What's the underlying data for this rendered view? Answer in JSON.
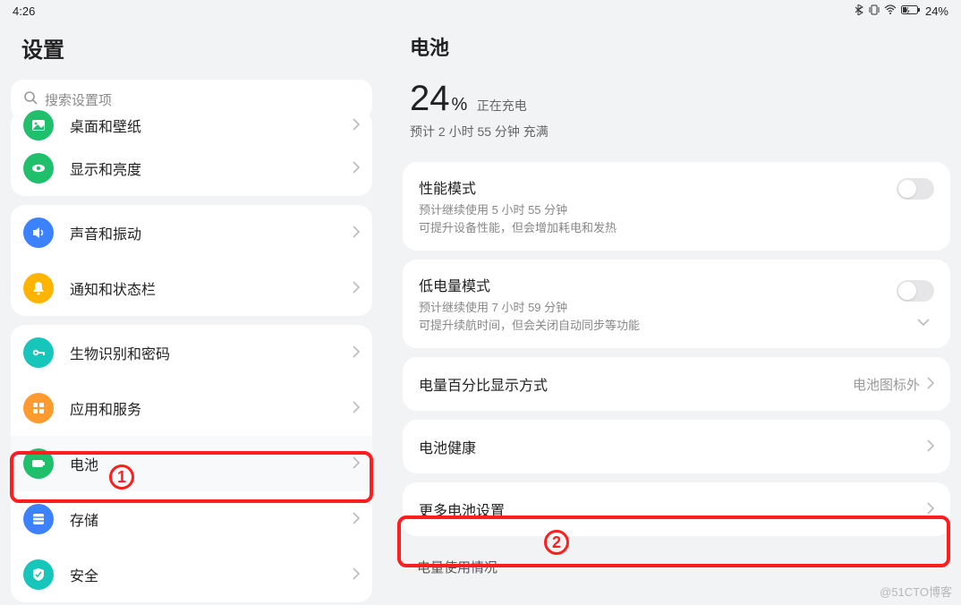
{
  "statusbar": {
    "time": "4:26",
    "battery_text": "24%"
  },
  "left": {
    "title": "设置",
    "search_placeholder": "搜索设置项",
    "groups": [
      {
        "items": [
          {
            "id": "wallpaper",
            "label": "桌面和壁纸",
            "icon_bg": "#1fbf6b",
            "icon": "image",
            "partial": true
          },
          {
            "id": "display",
            "label": "显示和亮度",
            "icon_bg": "#1fbf6b",
            "icon": "eye"
          }
        ]
      },
      {
        "items": [
          {
            "id": "sound",
            "label": "声音和振动",
            "icon_bg": "#3c82ff",
            "icon": "speaker"
          },
          {
            "id": "notif",
            "label": "通知和状态栏",
            "icon_bg": "#ffb400",
            "icon": "bell"
          }
        ]
      },
      {
        "items": [
          {
            "id": "biometric",
            "label": "生物识别和密码",
            "icon_bg": "#17c6bb",
            "icon": "key"
          },
          {
            "id": "apps",
            "label": "应用和服务",
            "icon_bg": "#ff9a2e",
            "icon": "grid"
          },
          {
            "id": "battery",
            "label": "电池",
            "icon_bg": "#1fbf6b",
            "icon": "battery",
            "highlight": true
          },
          {
            "id": "storage",
            "label": "存储",
            "icon_bg": "#3c82ff",
            "icon": "storage"
          },
          {
            "id": "security",
            "label": "安全",
            "icon_bg": "#17c6bb",
            "icon": "shield",
            "partial_bottom": true
          }
        ]
      }
    ]
  },
  "right": {
    "title": "电池",
    "percent": "24",
    "percent_unit": "%",
    "charging": "正在充电",
    "estimate_full": "预计 2 小时 55 分钟 充满",
    "perf_mode": {
      "title": "性能模式",
      "sub1": "预计继续使用 5 小时 55 分钟",
      "sub2": "可提升设备性能，但会增加耗电和发热"
    },
    "low_mode": {
      "title": "低电量模式",
      "sub1": "预计继续使用 7 小时 59 分钟",
      "sub2": "可提升续航时间，但会关闭自动同步等功能"
    },
    "pct_display": {
      "title": "电量百分比显示方式",
      "value": "电池图标外"
    },
    "health": {
      "title": "电池健康"
    },
    "more": {
      "title": "更多电池设置"
    },
    "usage_label": "电量使用情况"
  },
  "annotations": {
    "marker1": "1",
    "marker2": "2"
  },
  "watermark": "@51CTO博客"
}
